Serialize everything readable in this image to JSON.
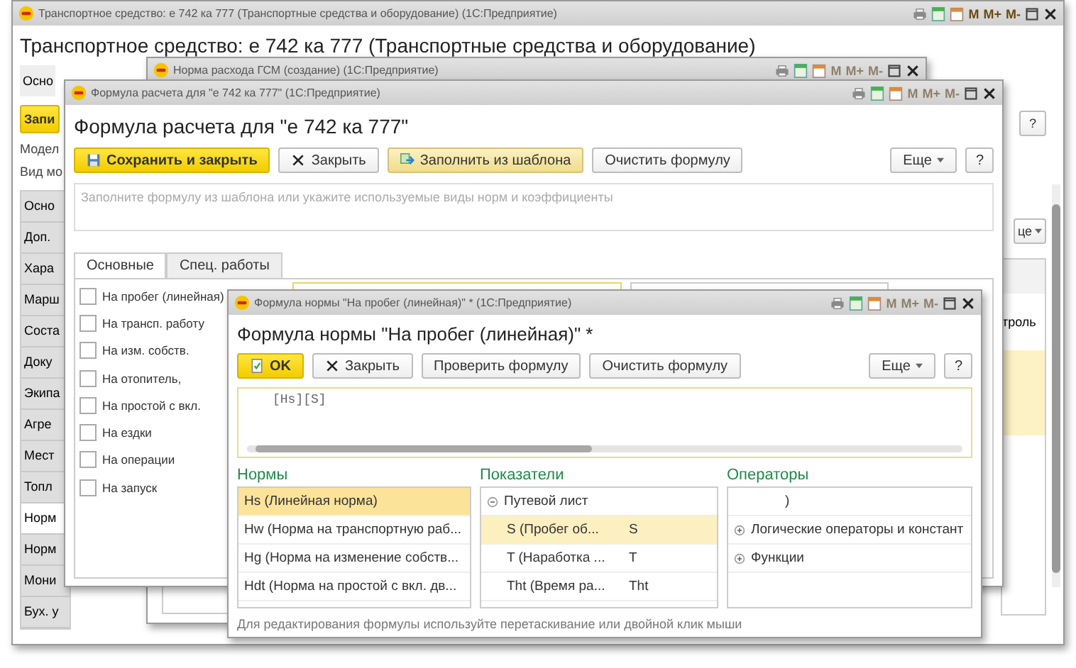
{
  "main_window": {
    "title": "Транспортное средство: е 742 ка 777 (Транспортные средства и оборудование)  (1С:Предприятие)",
    "memory_keys": [
      "M",
      "M+",
      "M-"
    ],
    "memory_enabled": true,
    "heading": "Транспортное средство: е 742 ка 777 (Транспортные средства и оборудование)",
    "tab": "Осно",
    "save_button": "Запи",
    "labels": [
      "Модел",
      "Вид мо"
    ],
    "side_items": [
      {
        "label": "Осно",
        "selected": false
      },
      {
        "label": "Доп.",
        "selected": false
      },
      {
        "label": "Хара",
        "selected": false
      },
      {
        "label": "Марш",
        "selected": false
      },
      {
        "label": "Соста",
        "selected": false
      },
      {
        "label": "Доку",
        "selected": false
      },
      {
        "label": "Экипа",
        "selected": false
      },
      {
        "label": "Агре",
        "selected": false
      },
      {
        "label": "Мест",
        "selected": false
      },
      {
        "label": "Топл",
        "selected": false
      },
      {
        "label": "Норм",
        "selected": true
      },
      {
        "label": "Норм",
        "selected": false
      },
      {
        "label": "Мони",
        "selected": false
      },
      {
        "label": "Бух. у",
        "selected": false
      }
    ],
    "help_button": "?",
    "more_button": "це",
    "table_cell": "троль"
  },
  "norm_window": {
    "title": "Норма расхода ГСМ (создание)  (1С:Предприятие)",
    "memory_keys": [
      "M",
      "M+",
      "M-"
    ],
    "memory_enabled": false
  },
  "formula_window": {
    "title": "Формула расчета для \"е 742 ка 777\"  (1С:Предприятие)",
    "memory_keys": [
      "M",
      "M+",
      "M-"
    ],
    "memory_enabled": false,
    "heading": "Формула расчета для \"е 742 ка 777\"",
    "buttons": [
      {
        "label": "Сохранить и закрыть",
        "kind": "primary"
      },
      {
        "label": "Закрыть",
        "kind": "close"
      },
      {
        "label": "Заполнить из шаблона",
        "kind": "template"
      },
      {
        "label": "Очистить формулу",
        "kind": "plain"
      }
    ],
    "more_button": "Еще",
    "help_button": "?",
    "formula_placeholder": "Заполните формулу из шаблона или укажите используемые виды норм и коэффициенты",
    "tabs": [
      {
        "label": "Основные",
        "selected": true
      },
      {
        "label": "Спец. работы",
        "selected": false
      }
    ],
    "norms": [
      {
        "label": "На пробег (линейная)",
        "checked": false
      },
      {
        "label": "На трансп. работу",
        "checked": false
      },
      {
        "label": "На изм. собств.",
        "checked": false
      },
      {
        "label": "На отопитель,",
        "checked": false
      },
      {
        "label": "На простой с вкл.",
        "checked": false
      },
      {
        "label": "На ездки",
        "checked": false
      },
      {
        "label": "На операции",
        "checked": false
      },
      {
        "label": "На запуск",
        "checked": false
      }
    ]
  },
  "norm_formula_window": {
    "title": "Формула нормы \"На пробег (линейная)\" *  (1С:Предприятие)",
    "memory_keys": [
      "M",
      "M+",
      "M-"
    ],
    "memory_enabled": false,
    "heading": "Формула нормы \"На пробег (линейная)\" *",
    "buttons": [
      {
        "label": "OK",
        "kind": "primary"
      },
      {
        "label": "Закрыть",
        "kind": "close"
      },
      {
        "label": "Проверить формулу",
        "kind": "plain"
      },
      {
        "label": "Очистить формулу",
        "kind": "plain"
      }
    ],
    "more_button": "Еще",
    "help_button": "?",
    "formula": "[Hs][S]",
    "norms_title": "Нормы",
    "norms": [
      {
        "label": "Hs (Линейная норма)",
        "selected": true
      },
      {
        "label": "Hw (Норма на транспортную раб...",
        "selected": false
      },
      {
        "label": "Hg (Норма на изменение собств...",
        "selected": false
      },
      {
        "label": "Hdt (Норма на простой с вкл. дв...",
        "selected": false
      }
    ],
    "indicators_title": "Показатели",
    "indicators": [
      {
        "label": "Путевой лист",
        "expanded": true,
        "children": [
          {
            "label": "S (Пробег об...",
            "code": "S",
            "selected": true
          },
          {
            "label": "T (Наработка ...",
            "code": "T",
            "selected": false
          },
          {
            "label": "Tht (Время ра...",
            "code": "Tht",
            "selected": false
          }
        ]
      }
    ],
    "operators_title": "Операторы",
    "operators": [
      {
        "label": ")",
        "kind": "item"
      },
      {
        "label": "Логические операторы и констант",
        "kind": "group",
        "expanded": false
      },
      {
        "label": "Функции",
        "kind": "group",
        "expanded": false
      }
    ],
    "hint": "Для редактирования формулы используйте перетаскивание или двойной клик мыши"
  }
}
